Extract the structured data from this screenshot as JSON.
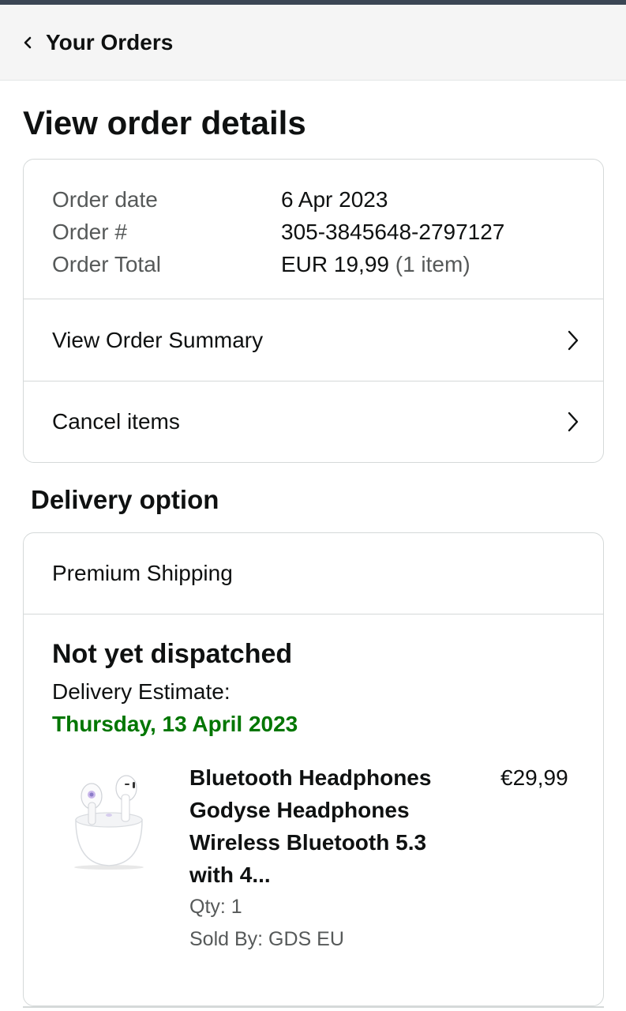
{
  "nav": {
    "back_label": "Your Orders"
  },
  "page_title": "View order details",
  "order": {
    "date_label": "Order date",
    "date_value": "6 Apr 2023",
    "number_label": "Order #",
    "number_value": "305-3845648-2797127",
    "total_label": "Order Total",
    "total_value": "EUR 19,99",
    "total_items": "(1 item)"
  },
  "links": {
    "summary": "View Order Summary",
    "cancel": "Cancel items"
  },
  "delivery": {
    "section_title": "Delivery option",
    "shipping_method": "Premium Shipping",
    "status": "Not yet dispatched",
    "estimate_label": "Delivery Estimate:",
    "estimate_date": "Thursday, 13 April 2023",
    "estimate_color": "#007600"
  },
  "item": {
    "title": "Bluetooth Headphones Godyse Headphones Wireless Bluetooth 5.3 with 4...",
    "price": "€29,99",
    "qty": "Qty: 1",
    "sold_by": "Sold By: GDS EU",
    "image_icon": "earbuds-product-image"
  }
}
